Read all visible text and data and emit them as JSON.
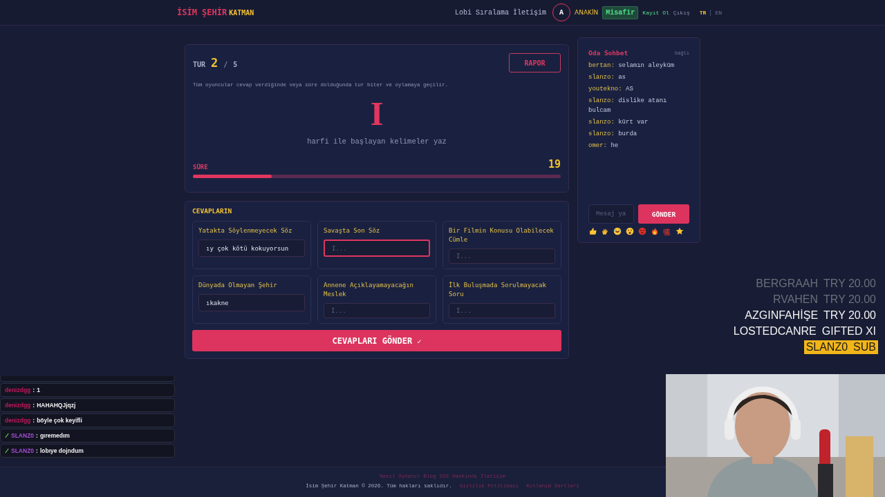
{
  "header": {
    "logo_main": "İSİM ŞEHİR",
    "logo_sub": "KATMAN",
    "nav": [
      "Lobi",
      "Sıralama",
      "İletişim"
    ],
    "user": {
      "avatar_letter": "A",
      "name": "ANAKİN",
      "role": "Misafir"
    },
    "auth_links": [
      "Kayıt Ol",
      "Çıkış"
    ],
    "languages": [
      {
        "label": "TR",
        "selected": true
      },
      {
        "label": "EN",
        "selected": false
      }
    ]
  },
  "round_card": {
    "round_label": "TUR",
    "round_current": "2",
    "round_separator": "/",
    "round_total": "5",
    "report_button": "RAPOR",
    "info": "Tüm oyuncular cevap verdiğinde veya süre dolduğunda tur biter ve oylamaya geçilir.",
    "letter": "I",
    "instruction": "harfi ile başlayan kelimeler yaz",
    "timer": {
      "label": "SÜRE",
      "value": "19",
      "level": 0.215
    }
  },
  "answers": {
    "title": "CEVAPLARIN",
    "fields": [
      {
        "category": "Yatakta Söylenmeyecek Söz",
        "value": "ıy çok kötü kokuyorsun",
        "focused": false
      },
      {
        "category": "Savaşta Son Söz",
        "placeholder": "I...",
        "focused": true
      },
      {
        "category": "Bir Filmin Konusu Olabilecek Cümle",
        "placeholder": "I...",
        "focused": false
      },
      {
        "category": "Dünyada Olmayan Şehir",
        "value": "ıkakne",
        "focused": false
      },
      {
        "category": "Annene Açıklayamayacağın Meslek",
        "placeholder": "I...",
        "focused": false
      },
      {
        "category": "İlk Buluşmada Sorulmayacak Soru",
        "placeholder": "I...",
        "focused": false
      }
    ],
    "submit_button": "CEVAPLARI GÖNDER",
    "submit_mark": "✓"
  },
  "room_chat": {
    "title": "Oda Sohbet",
    "status": "bağlı",
    "messages": [
      {
        "user": "bertan:",
        "text": "selamın aleyküm"
      },
      {
        "user": "slanzo:",
        "text": "as"
      },
      {
        "user": "youtekno:",
        "text": "AS"
      },
      {
        "user": "slanzo:",
        "text": "dislike atanı bulcam"
      },
      {
        "user": "slanzo:",
        "text": "kürt var"
      },
      {
        "user": "slanzo:",
        "text": "burda"
      },
      {
        "user": "omer:",
        "text": "he"
      }
    ],
    "input_placeholder": "Mesaj ya",
    "send_button": "GÖNDER",
    "reactions": [
      {
        "kind": "thumbs_up"
      },
      {
        "kind": "clap"
      },
      {
        "kind": "laugh"
      },
      {
        "kind": "surprised"
      },
      {
        "kind": "angry"
      },
      {
        "kind": "fire"
      },
      {
        "kind": "hundred"
      },
      {
        "kind": "star"
      }
    ]
  },
  "stream_chat": [
    {
      "user": "denizdgg",
      "separator": ":",
      "text": "1",
      "color": "#c2185b",
      "badge": false
    },
    {
      "user": "denizdgg",
      "separator": ":",
      "text": "HAHAHQJjqzj",
      "color": "#c2185b",
      "badge": false
    },
    {
      "user": "denizdgg",
      "separator": ":",
      "text": "böyle çok keyifli",
      "color": "#c2185b",
      "badge": false
    },
    {
      "user": "SLANZ0",
      "separator": ":",
      "text": "gıremedım",
      "color": "#a64bd8",
      "badge": true
    },
    {
      "user": "SLANZ0",
      "separator": ":",
      "text": "lobıye dojndum",
      "color": "#a64bd8",
      "badge": true
    }
  ],
  "stream_events": [
    {
      "name": "BERGRAAH",
      "detail": "TRY 20.00",
      "faded": true,
      "highlighted": false
    },
    {
      "name": "RVAHEN",
      "detail": "TRY 20.00",
      "faded": true,
      "highlighted": false
    },
    {
      "name": "AZGINFAHİŞE",
      "detail": "TRY 20.00",
      "faded": false,
      "highlighted": false
    },
    {
      "name": "LOSTEDCANRE",
      "detail": "GIFTED XI",
      "faded": false,
      "highlighted": false
    },
    {
      "name": "SLANZ0",
      "detail": "SUB",
      "faded": false,
      "highlighted": true
    }
  ],
  "footer": {
    "links": [
      "Nasıl Oynanır",
      "Blog",
      "SSS",
      "Hakkında",
      "İletişim"
    ],
    "copyright": "İsim Şehir Katman © 2026. Tüm hakları saklıdır.",
    "legal_links": [
      "Gizlilik Politikası",
      "Kullanım Şartları"
    ]
  }
}
